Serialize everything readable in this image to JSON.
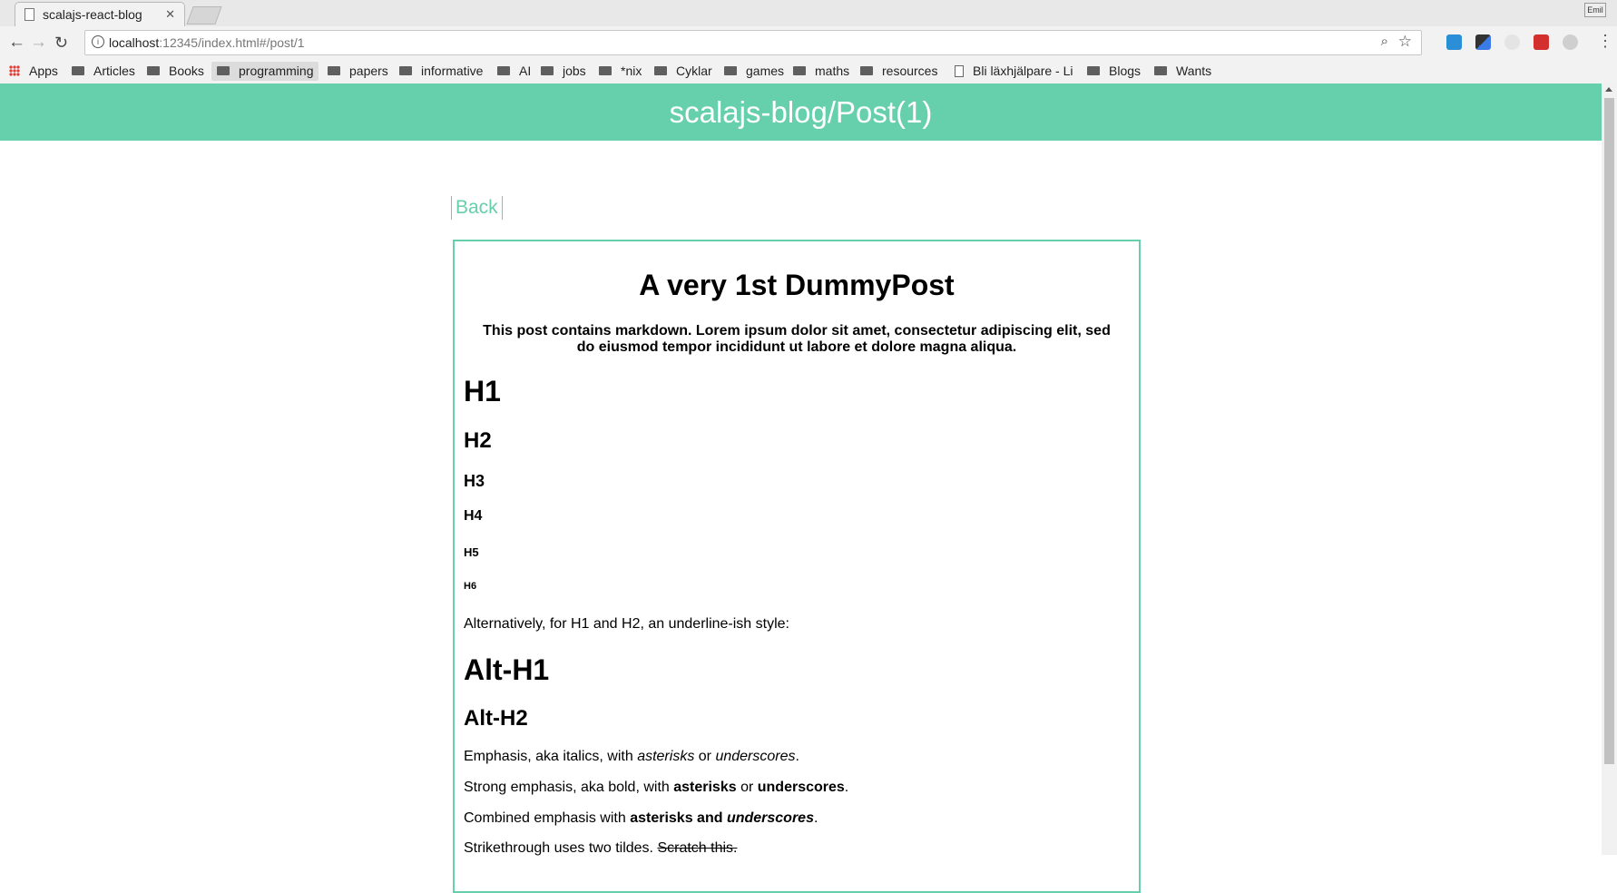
{
  "browser": {
    "tab_title": "scalajs-react-blog",
    "tab_close": "✕",
    "user_badge": "Emil",
    "url_host": "localhost",
    "url_rest": ":12345/index.html#/post/1",
    "bookmarks": [
      "Apps",
      "Articles",
      "Books",
      "programming",
      "papers",
      "informative",
      "AI",
      "jobs",
      "*nix",
      "Cyklar",
      "games",
      "maths",
      "resources",
      "Bli läxhjälpare - Li",
      "Blogs",
      "Wants"
    ]
  },
  "page": {
    "site_title": "scalajs-blog/Post(1)",
    "back_label": "Back",
    "post": {
      "title": "A very 1st DummyPost",
      "description": "This post contains markdown. Lorem ipsum dolor sit amet, consectetur adipiscing elit, sed do eiusmod tempor incididunt ut labore et dolore magna aliqua.",
      "h1": "H1",
      "h2": "H2",
      "h3": "H3",
      "h4": "H4",
      "h5": "H5",
      "h6": "H6",
      "alt_intro": "Alternatively, for H1 and H2, an underline-ish style:",
      "alt_h1": "Alt-H1",
      "alt_h2": "Alt-H2",
      "emph": {
        "a": "Emphasis, aka italics, with ",
        "b": "asterisks",
        "c": " or ",
        "d": "underscores",
        "e": "."
      },
      "strong": {
        "a": "Strong emphasis, aka bold, with ",
        "b": "asterisks",
        "c": " or ",
        "d": "underscores",
        "e": "."
      },
      "combined": {
        "a": "Combined emphasis with ",
        "b": "asterisks and ",
        "c": "underscores",
        "d": "."
      },
      "strike": {
        "a": "Strikethrough uses two tildes. ",
        "b": "Scratch this."
      }
    }
  },
  "colors": {
    "accent": "#66cfab"
  }
}
